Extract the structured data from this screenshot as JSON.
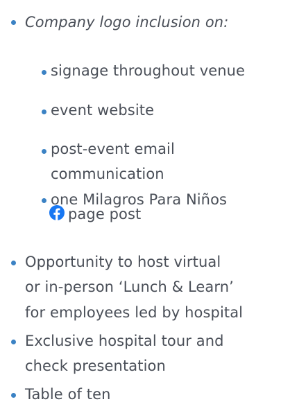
{
  "content": {
    "heading_item": "Company logo inclusion on:",
    "sub_items": [
      "signage throughout venue",
      "event website",
      "post-event email",
      "communication",
      "one Milagros Para Niños",
      "page post"
    ],
    "items": [
      "Opportunity to host virtual",
      "or in-person ‘Lunch & Learn’",
      "for employees led by hospital",
      "Exclusive hospital tour and",
      "check presentation",
      "Table of ten"
    ]
  },
  "icons": {
    "social": "facebook-icon"
  },
  "colors": {
    "text": "#4a4f58",
    "bullet": "#3b82c4",
    "facebook": "#1877f2"
  }
}
